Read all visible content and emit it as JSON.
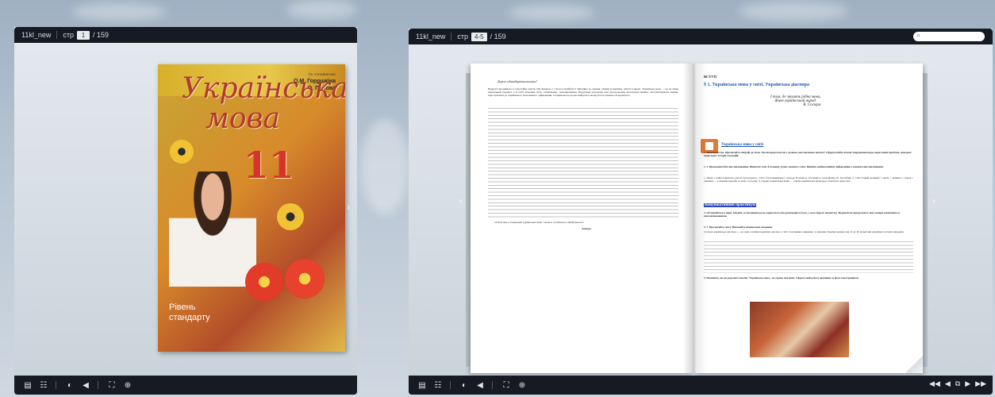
{
  "viewer1": {
    "title": "11kl_new",
    "page_label": "стр",
    "page_input": "1",
    "page_total": "/ 159"
  },
  "viewer2": {
    "title": "11kl_new",
    "page_label": "стр",
    "page_input": "4-5",
    "page_total": "/ 159",
    "search_placeholder": ""
  },
  "cover": {
    "authors_small": "Т.В. ГОЛОВЧЕНКО",
    "author1": "О.М. Горошкіна",
    "author2": "А.О. Попова",
    "title_line1": "Українська",
    "title_line2": "мова",
    "grade": "11",
    "level_line1": "Рівень",
    "level_line2": "стандарту"
  },
  "left_page": {
    "greeting": "Дорогі одинадцятикласники!",
    "body": "Невдовзі ви вийдете в самостійне життя. Що візьмете з собою в майбутнє? Звичайно ж, знання, уміння й навички, набуті в школі. Українська мова — це не лише навчальний предмет, а й засіб пізнання світу, спілкування, самовираження. Підручник допоможе вам удосконалити мовленнєві вміння, систематизувати знання, підготуватися до зовнішнього незалежного оцінювання. Сподіваємося, що ви знайдете в ньому багато цікавого й корисного.",
    "wish": "Успіхів вам в опануванні української мови і вашого життєвого майбутнього!",
    "sign": "Автори"
  },
  "right_page": {
    "section": "ВСТУП",
    "heading": "§ 1. Українська мова у світі. Українська діаспора",
    "epigraph1": "І там, де звучить рідна мова,",
    "epigraph2": "Живе український народ.",
    "epigraph_author": "В. Сосюра",
    "slide_title": "Українська мова у світі",
    "task1": "1. Мовознавство. Прочитайте епіграф до теми. Чи погоджуєтеся ви з думкою, висловленою поетом? Сформулюйте власні твердження щодо окреслених проблем, наводьте приклади з історії, географії.",
    "task2": "2. 1. Прокоментуйте висловлювання. Визначте тему й основну думку кожного з них. Виявіть найважливішу інформацію з кожного висловлювання.",
    "text": "1. Мова є найголовнішою рисою культурного, тобто багатовимірного, народу. В кінці ж обставин в географічні (О. Потебня). 2. Світ божий великий, і скрізь є людина, і скрізь є українці — в першім народів та мові, в усьому. 3. Справа української мови — справа української культури, і нам бути через неї.",
    "practicum": "Комунікативний практикум",
    "task3": "3. Об’єднайтеся в пари. Оберіть за бажанням роль журналіста або респондента (того, у кого беруть інтерв’ю). Журналісти придумують три-чотири запитання за висловлюваннями.",
    "task4": "4. 1. Прочитайте текст. Виконайте пізнавальні завдання.",
    "text2": "Сучасна українська діаспора — це одна з найчисельніших діаспор у світі. За різними оцінками, за межами України мешкає від 12 до 20 мільйонів українців та їхніх нащадків.",
    "task5": "5. Напишіть, як ви розумієте вислів: Українська мова... не гірша, ніж інші. Сформулюйте його значення за фото-ілюстраціями."
  },
  "colors": {
    "toolbar": "#161a22",
    "accent_blue": "#1a56b0",
    "highlight": "#2a43c0"
  }
}
